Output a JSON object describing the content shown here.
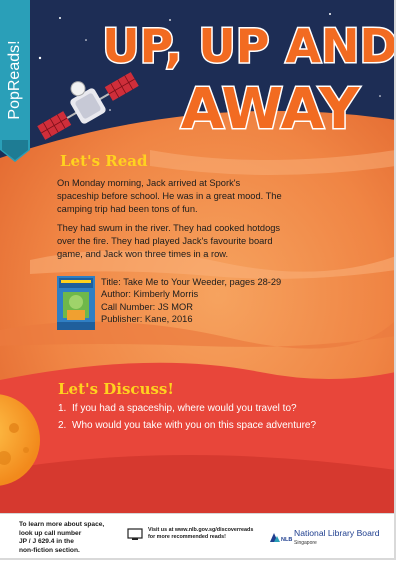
{
  "bookmark": {
    "label": "PopReads!"
  },
  "title": {
    "line1": "UP, UP AND",
    "line2": "AWAY"
  },
  "read": {
    "heading": "Let's Read",
    "paragraph1": "On Monday morning, Jack arrived at Spork's spaceship before school. He was in a great mood. The camping trip had been tons of fun.",
    "paragraph2": "They had swum in the river. They had cooked hotdogs over the fire. They had played Jack's favourite board game, and Jack won three times in a row."
  },
  "book": {
    "title_label": "Title:",
    "title_value": "Take Me to Your Weeder, pages 28-29",
    "author": "Author: Kimberly Morris",
    "call_number": "Call Number: JS MOR",
    "publisher": "Publisher: Kane, 2016"
  },
  "discuss": {
    "heading": "Let's Discuss!",
    "questions": [
      {
        "num": "1.",
        "text": "If you had a spaceship, where would you travel to?"
      },
      {
        "num": "2.",
        "text": "Who would you take with you on this space adventure?"
      }
    ]
  },
  "footer": {
    "learn_line1": "To learn more about space,",
    "learn_line2": "look up call number",
    "learn_line3": "JP / J 629.4  in the",
    "learn_line4": "non-fiction section.",
    "visit_line1": "Visit us at www.nlb.gov.sg/discoverreads",
    "visit_line2": "for more recommended reads!",
    "nlb_name": "National Library Board",
    "nlb_country": "Singapore",
    "nlb_mark": "NLB"
  },
  "colors": {
    "space": "#1d2d55",
    "planet": "#f18a4a",
    "discuss_band": "#e8463a",
    "heading_yellow": "#ffd21f",
    "title_orange": "#f26b21",
    "bookmark": "#2a9fb8"
  }
}
